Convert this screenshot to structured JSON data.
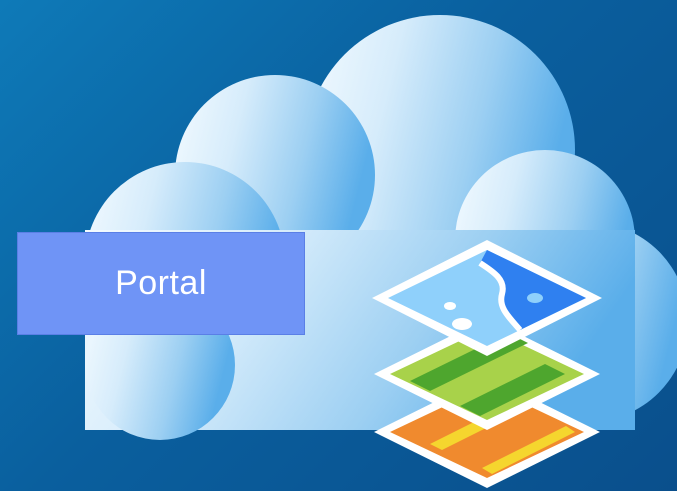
{
  "portal": {
    "label": "Portal"
  },
  "icons": {
    "cloud": "cloud-icon",
    "map_layers": "map-layers-icon"
  },
  "colors": {
    "background": "#0a5f9e",
    "cloud_light": "#eef7fd",
    "cloud_dark": "#5aaeea",
    "portal_box": "#6f94f6",
    "water": "#2f80f0",
    "land": "#8fd0fb",
    "grass_light": "#a8d24a",
    "grass_dark": "#4ea62e",
    "orange": "#f08a2e",
    "yellow": "#f5d62e"
  }
}
